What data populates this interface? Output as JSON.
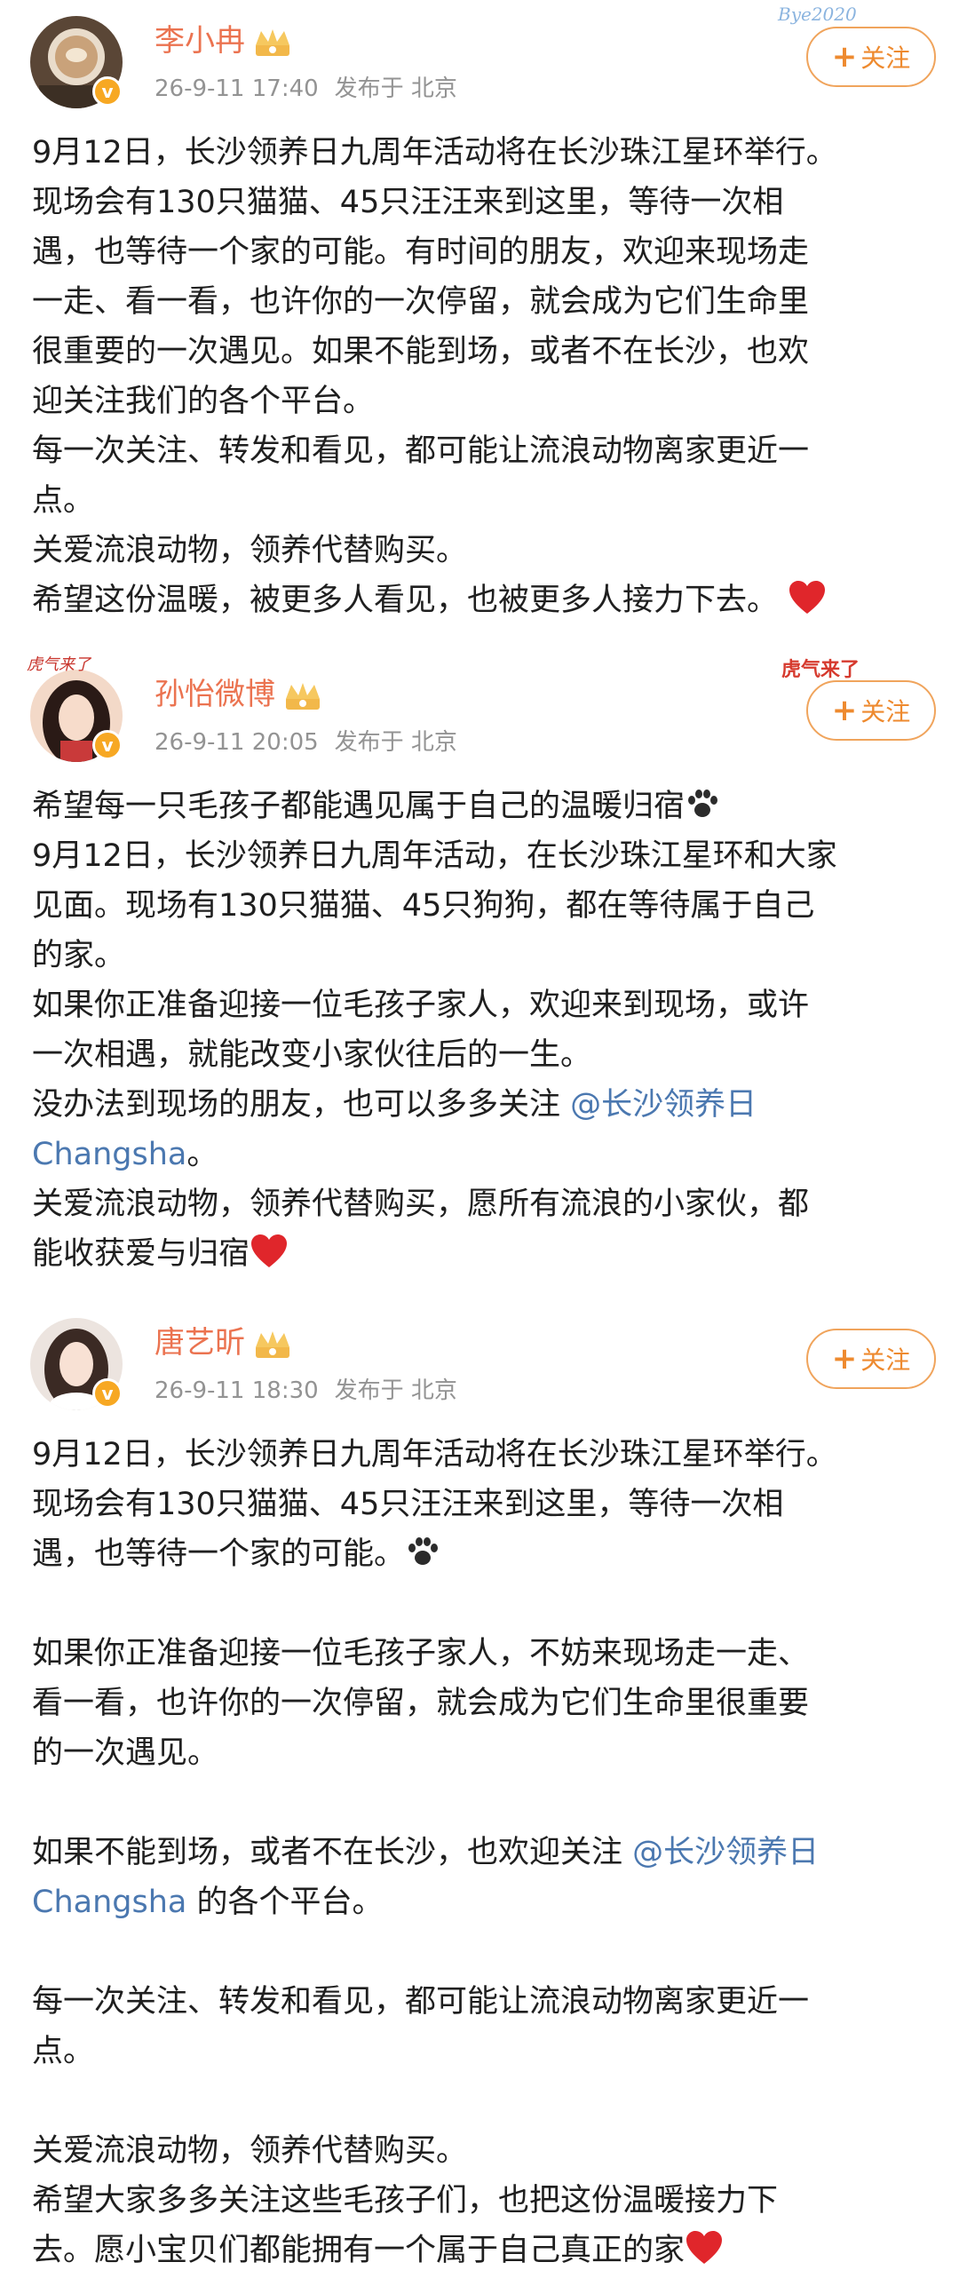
{
  "posts": [
    {
      "username": "李小冉",
      "time": "26-9-11 17:40",
      "location": "发布于 北京",
      "follow_label": "关注",
      "follow_plus": "+",
      "decoration": "Bye2020",
      "body": [
        "9月12日，长沙领养日九周年活动将在长沙珠江星环举行。",
        "现场会有130只猫猫、45只汪汪来到这里，等待一次相",
        "遇，也等待一个家的可能。有时间的朋友，欢迎来现场走",
        "一走、看一看，也许你的一次停留，就会成为它们生命里",
        "很重要的一次遇见。如果不能到场，或者不在长沙，也欢",
        "迎关注我们的各个平台。",
        "每一次关注、转发和看见，都可能让流浪动物离家更近一",
        "点。",
        "关爱流浪动物，领养代替购买。",
        "希望这份温暖，被更多人看见，也被更多人接力下去。"
      ]
    },
    {
      "username": "孙怡微博",
      "time": "26-9-11 20:05",
      "location": "发布于 北京",
      "follow_label": "关注",
      "follow_plus": "+",
      "decoration": "虎气来了",
      "body": [
        "希望每一只毛孩子都能遇见属于自己的温暖归宿",
        "9月12日，长沙领养日九周年活动，在长沙珠江星环和大家",
        "见面。现场有130只猫猫、45只狗狗，都在等待属于自己",
        "的家。",
        "如果你正准备迎接一位毛孩子家人，欢迎来到现场，或许",
        "一次相遇，就能改变小家伙往后的一生。",
        "没办法到现场的朋友，也可以多多关注",
        "关爱流浪动物，领养代替购买，愿所有流浪的小家伙，都",
        "能收获爱与归宿"
      ],
      "mention_a": "@长沙领养日",
      "mention_b": "Changsha",
      "mention_tail": "。"
    },
    {
      "username": "唐艺昕",
      "time": "26-9-11 18:30",
      "location": "发布于 北京",
      "follow_label": "关注",
      "follow_plus": "+",
      "body": [
        "9月12日，长沙领养日九周年活动将在长沙珠江星环举行。",
        "现场会有130只猫猫、45只汪汪来到这里，等待一次相",
        "遇，也等待一个家的可能。",
        "如果你正准备迎接一位毛孩子家人，不妨来现场走一走、",
        "看一看，也许你的一次停留，就会成为它们生命里很重要",
        "的一次遇见。",
        "如果不能到场，或者不在长沙，也欢迎关注",
        "的各个平台。",
        "每一次关注、转发和看见，都可能让流浪动物离家更近一",
        "点。",
        "关爱流浪动物，领养代替购买。",
        "希望大家多多关注这些毛孩子们，也把这份温暖接力下",
        "去。愿小宝贝们都能拥有一个属于自己真正的家"
      ],
      "mention_a": "@长沙领养日",
      "mention_b": "Changsha"
    }
  ],
  "colors": {
    "username": "#eb7350",
    "meta": "#939393",
    "follow": "#ee8a2f",
    "mention": "#4b78b0",
    "heart": "#e0262b"
  },
  "icons": [
    "crown-icon",
    "verified-icon",
    "heart-icon",
    "paw-icon",
    "plus-icon"
  ]
}
